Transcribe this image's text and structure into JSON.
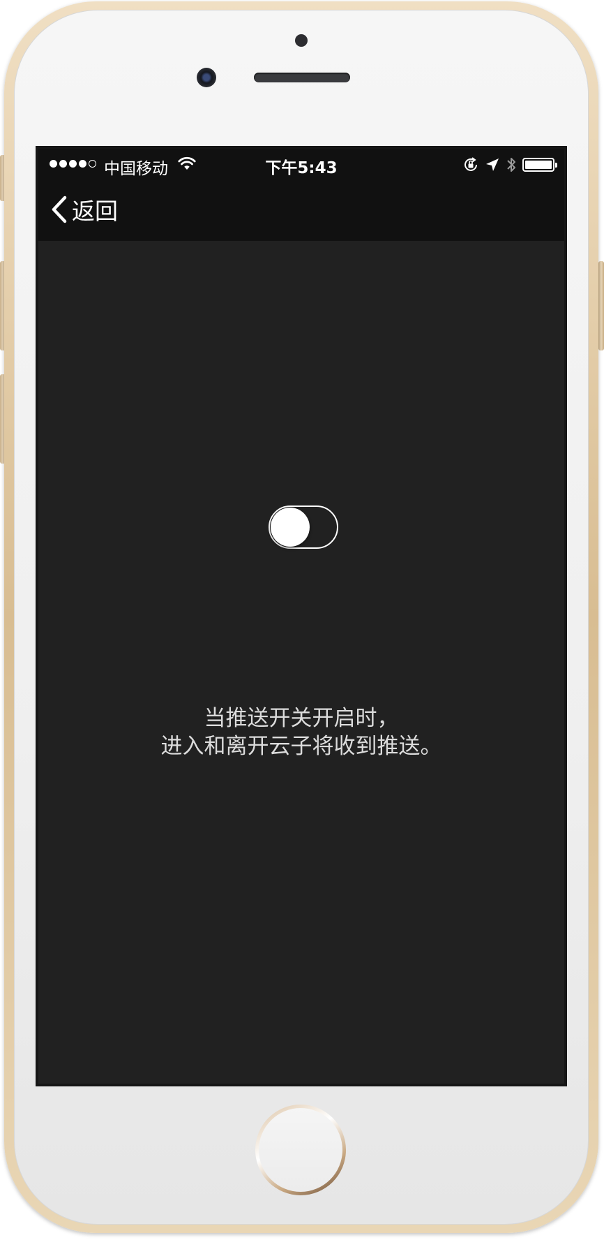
{
  "status_bar": {
    "carrier": "中国移动",
    "time": "下午5:43",
    "signal_bars_filled": 4,
    "signal_bars_total": 5,
    "battery_level": 1.0,
    "icons": [
      "wifi-icon",
      "rotation-lock-icon",
      "location-arrow-icon",
      "bluetooth-icon",
      "battery-icon"
    ]
  },
  "nav": {
    "back_label": "返回",
    "back_icon": "chevron-left-icon"
  },
  "push_toggle": {
    "state": "off"
  },
  "description": {
    "line1": "当推送开关开启时，",
    "line2": "进入和离开云子将收到推送。"
  },
  "colors": {
    "screen_bg": "#212121",
    "bar_bg": "#111111",
    "text": "#dcdcdc",
    "frame_gold": "#d8bd92"
  }
}
